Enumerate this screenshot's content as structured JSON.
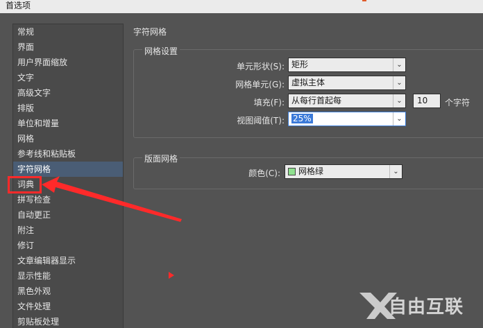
{
  "window": {
    "title": "首选项"
  },
  "sidebar": {
    "items": [
      {
        "label": "常规"
      },
      {
        "label": "界面"
      },
      {
        "label": "用户界面缩放"
      },
      {
        "label": "文字"
      },
      {
        "label": "高级文字"
      },
      {
        "label": "排版"
      },
      {
        "label": "单位和增量"
      },
      {
        "label": "网格"
      },
      {
        "label": "参考线和粘贴板"
      },
      {
        "label": "字符网格",
        "selected": true
      },
      {
        "label": "词典"
      },
      {
        "label": "拼写检查"
      },
      {
        "label": "自动更正"
      },
      {
        "label": "附注"
      },
      {
        "label": "修订"
      },
      {
        "label": "文章编辑器显示"
      },
      {
        "label": "显示性能"
      },
      {
        "label": "黑色外观"
      },
      {
        "label": "文件处理"
      },
      {
        "label": "剪贴板处理"
      }
    ]
  },
  "main": {
    "section_title": "字符网格",
    "grid_settings": {
      "group_label": "网格设置",
      "cell_shape_label": "单元形状(S):",
      "cell_shape_value": "矩形",
      "grid_unit_label": "网格单元(G):",
      "grid_unit_value": "虚拟主体",
      "fill_label": "填充(F):",
      "fill_value": "从每行首起每",
      "fill_count": "10",
      "fill_unit": "个字符",
      "view_threshold_label": "视图阈值(T):",
      "view_threshold_value": "25%"
    },
    "layout_grid": {
      "group_label": "版面网格",
      "color_label": "颜色(C):",
      "color_value": "网格绿",
      "color_hex": "#8fe08f"
    }
  },
  "watermark": {
    "text": "自由互联"
  },
  "colors": {
    "annotation_red": "#ff2a2a",
    "selection_blue": "#4a5d75"
  }
}
